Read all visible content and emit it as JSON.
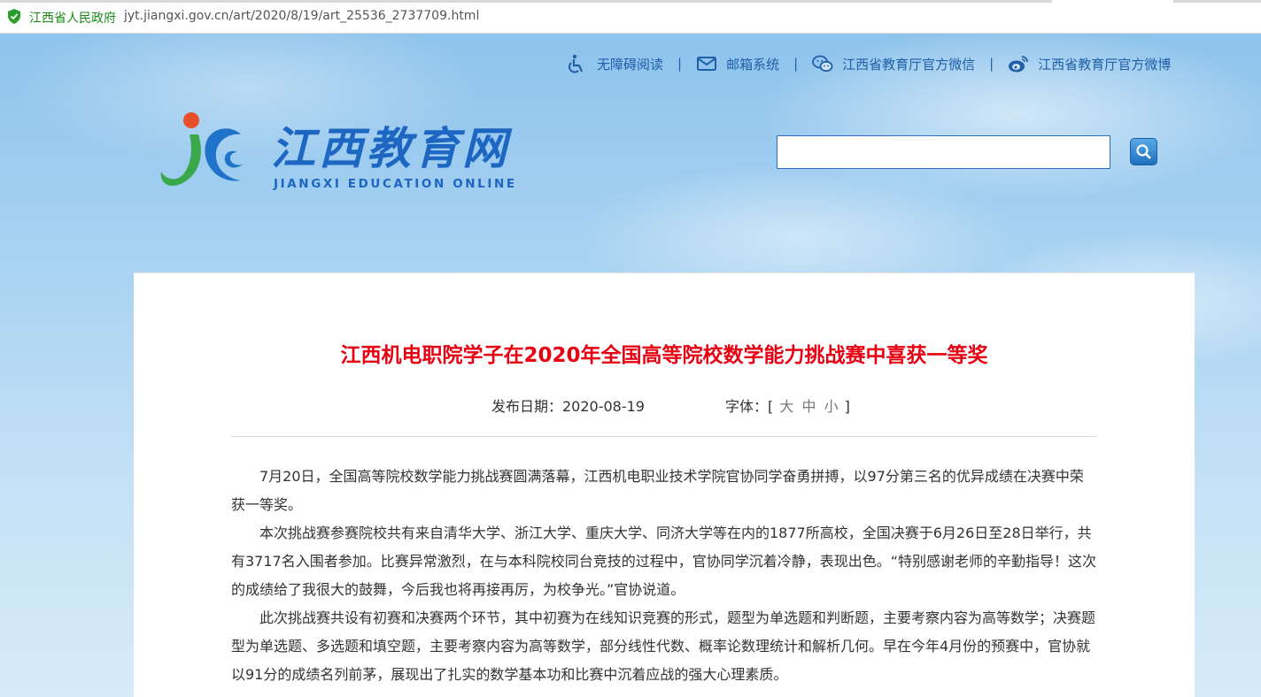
{
  "browser": {
    "site_name": "江西省人民政府",
    "url": "jyt.jiangxi.gov.cn/art/2020/8/19/art_25536_2737709.html"
  },
  "toplinks": [
    {
      "label": "无障碍阅读",
      "icon": "accessibility-icon"
    },
    {
      "label": "邮箱系统",
      "icon": "mail-icon"
    },
    {
      "label": "江西省教育厅官方微信",
      "icon": "wechat-icon"
    },
    {
      "label": "江西省教育厅官方微博",
      "icon": "weibo-icon"
    }
  ],
  "separator": "|",
  "logo": {
    "title": "江西教育网",
    "subtitle": "JIANGXI EDUCATION ONLINE"
  },
  "search": {
    "value": "",
    "placeholder": ""
  },
  "article": {
    "title": "江西机电职院学子在2020年全国高等院校数学能力挑战赛中喜获一等奖",
    "date_label": "发布日期：2020-08-19",
    "font_label": "字体：[",
    "font_sizes": [
      "大",
      "中",
      "小"
    ],
    "font_close": "]",
    "paragraphs": [
      "7月20日，全国高等院校数学能力挑战赛圆满落幕，江西机电职业技术学院官协同学奋勇拼搏，以97分第三名的优异成绩在决赛中荣获一等奖。",
      "本次挑战赛参赛院校共有来自清华大学、浙江大学、重庆大学、同济大学等在内的1877所高校，全国决赛于6月26日至28日举行，共有3717名入围者参加。比赛异常激烈，在与本科院校同台竞技的过程中，官协同学沉着冷静，表现出色。“特别感谢老师的辛勤指导！这次的成绩给了我很大的鼓舞，今后我也将再接再厉，为校争光。”官协说道。",
      "此次挑战赛共设有初赛和决赛两个环节，其中初赛为在线知识竞赛的形式，题型为单选题和判断题，主要考察内容为高等数学；决赛题型为单选题、多选题和填空题，主要考察内容为高等数学，部分线性代数、概率论数理统计和解析几何。早在今年4月份的预赛中，官协就以91分的成绩名列前茅，展现出了扎实的数学基本功和比赛中沉着应战的强大心理素质。"
    ]
  },
  "colors": {
    "title_red": "#e60012",
    "link_blue": "#1f5fa8",
    "secure_green": "#1a8a1a"
  }
}
